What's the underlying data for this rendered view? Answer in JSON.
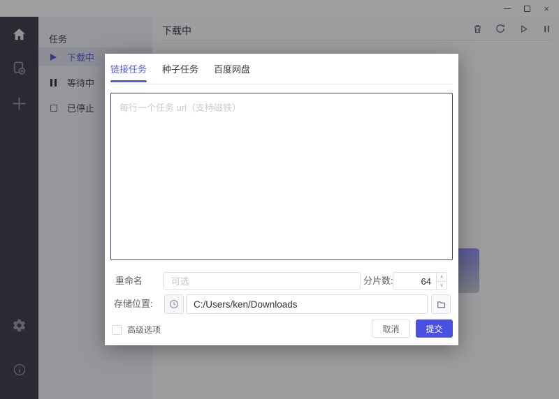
{
  "window": {
    "close_glyph": "×"
  },
  "app_sidebar": {
    "icons": [
      "home",
      "new-task",
      "plus",
      "settings",
      "info"
    ]
  },
  "tasks_panel": {
    "title": "任务",
    "items": [
      {
        "label": "下载中",
        "active": true
      },
      {
        "label": "等待中",
        "active": false
      },
      {
        "label": "已停止",
        "active": false
      }
    ]
  },
  "main": {
    "title": "下载中",
    "toolbar_icons": [
      "delete",
      "refresh",
      "resume",
      "pause"
    ]
  },
  "dialog": {
    "tabs": [
      {
        "label": "链接任务",
        "active": true
      },
      {
        "label": "种子任务",
        "active": false
      },
      {
        "label": "百度网盘",
        "active": false
      }
    ],
    "url_input": {
      "value": "",
      "placeholder": "每行一个任务 url（支持磁铁）"
    },
    "rename": {
      "label": "重命名",
      "placeholder": "可选",
      "value": ""
    },
    "splits": {
      "label": "分片数:",
      "value": "64"
    },
    "location": {
      "label": "存储位置:",
      "value": "C:/Users/ken/Downloads"
    },
    "advanced": {
      "label": "高级选项",
      "checked": false
    },
    "cancel_label": "取消",
    "submit_label": "提交"
  },
  "colors": {
    "accent": "#5558dc",
    "submit_bg": "#4a51e0",
    "sidebar_bg": "#3b3d43",
    "panel_bg": "#eff0f2",
    "overlay": "rgba(18,18,24,0.40)"
  }
}
